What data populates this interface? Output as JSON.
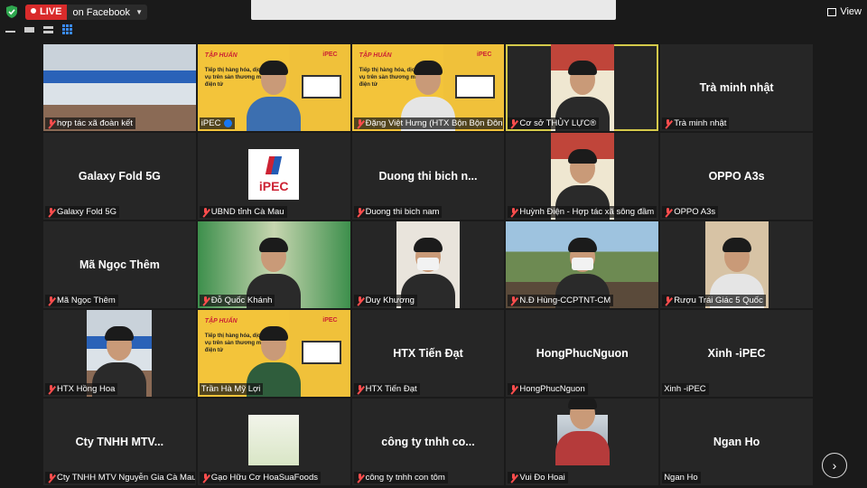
{
  "topbar": {
    "live_label": "LIVE",
    "platform_label": "on Facebook",
    "view_label": "View"
  },
  "colors": {
    "live": "#d92b2b",
    "active_speaker": "#d4c94a",
    "muted_mic": "#ff4d4d",
    "tile_bg": "#262626"
  },
  "banner": {
    "title": "TẬP HUẤN",
    "text": "Tiếp thị hàng hóa, dịch vụ trên sàn thương mại điện tử",
    "logo": "iPEC"
  },
  "ipec_logo_text": "iPEC",
  "tiles": [
    {
      "kind": "room",
      "display_name": "",
      "caption": "hợp tác xã đoàn kết",
      "muted": true
    },
    {
      "kind": "banner",
      "display_name": "",
      "caption": "iPEC",
      "muted": false,
      "facebook": true
    },
    {
      "kind": "banner",
      "display_name": "",
      "caption": "Đặng Việt Hưng (HTX Bộn Bộn Đôn...",
      "muted": true
    },
    {
      "kind": "sign",
      "display_name": "",
      "caption": "Cơ sở THỦY LỰC®",
      "muted": true,
      "active": true
    },
    {
      "kind": "name",
      "display_name": "Trà minh nhật",
      "caption": "Trà minh nhật",
      "muted": true
    },
    {
      "kind": "name",
      "display_name": "Galaxy Fold 5G",
      "caption": "Galaxy Fold 5G",
      "muted": true
    },
    {
      "kind": "ipec",
      "display_name": "",
      "caption": "UBND tỉnh Cà Mau",
      "muted": true
    },
    {
      "kind": "name",
      "display_name": "Duong thi bich n...",
      "caption": "Duong thi bich nam",
      "muted": true
    },
    {
      "kind": "sign",
      "display_name": "",
      "caption": "Huỳnh Điện - Hợp tác xã sông đầm",
      "muted": true
    },
    {
      "kind": "name",
      "display_name": "OPPO A3s",
      "caption": "OPPO A3s",
      "muted": true
    },
    {
      "kind": "name",
      "display_name": "Mã Ngọc Thêm",
      "caption": "Mã Ngọc Thêm",
      "muted": true
    },
    {
      "kind": "shop",
      "display_name": "",
      "caption": "Đỗ Quốc Khánh",
      "muted": true
    },
    {
      "kind": "mask",
      "display_name": "",
      "caption": "Duy Khương",
      "muted": true
    },
    {
      "kind": "outdoor",
      "display_name": "",
      "caption": "N.Đ Hùng-CCPTNT-CM",
      "muted": true
    },
    {
      "kind": "phone",
      "display_name": "",
      "caption": "Rượu Trái Giác 5 Quốc",
      "muted": true
    },
    {
      "kind": "room2",
      "display_name": "",
      "caption": "HTX Hồng Hoa",
      "muted": true
    },
    {
      "kind": "banner2",
      "display_name": "",
      "caption": "Trần Hà Mỹ Lợi",
      "muted": false
    },
    {
      "kind": "name",
      "display_name": "HTX Tiến Đạt",
      "caption": "HTX Tiến Đạt",
      "muted": true
    },
    {
      "kind": "name",
      "display_name": "HongPhucNguon",
      "caption": "HongPhucNguon",
      "muted": true
    },
    {
      "kind": "name",
      "display_name": "Xinh -iPEC",
      "caption": "Xinh -iPEC",
      "muted": false
    },
    {
      "kind": "name",
      "display_name": "Cty TNHH MTV...",
      "caption": "Cty TNHH MTV Nguyễn Gia Cà Mau",
      "muted": true
    },
    {
      "kind": "food",
      "display_name": "",
      "caption": "Gạo Hữu Cơ HoaSuaFoods",
      "muted": true
    },
    {
      "kind": "name",
      "display_name": "công ty tnhh co...",
      "caption": "công ty tnhh con tôm",
      "muted": true
    },
    {
      "kind": "selfie",
      "display_name": "",
      "caption": "Vui Đo Hoai",
      "muted": true
    },
    {
      "kind": "name",
      "display_name": "Ngan Ho",
      "caption": "Ngan Ho",
      "muted": false
    }
  ],
  "icons": {
    "security": "shield-icon",
    "layouts": [
      "speaker-layout-icon",
      "filmstrip-layout-icon",
      "immersive-layout-icon",
      "gallery-layout-icon"
    ],
    "view": "grid-icon",
    "muted": "muted-mic-icon",
    "next_page": "chevron-right-icon"
  },
  "next_symbol": "›"
}
